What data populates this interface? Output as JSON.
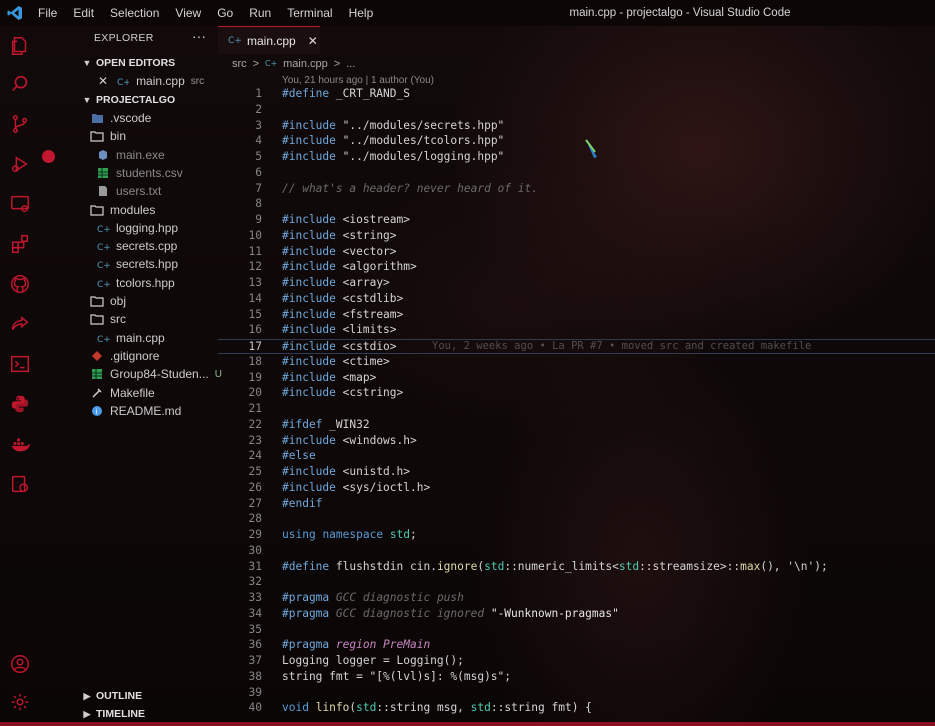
{
  "window": {
    "title": "main.cpp - projectalgo - Visual Studio Code"
  },
  "menu": [
    "File",
    "Edit",
    "Selection",
    "View",
    "Go",
    "Run",
    "Terminal",
    "Help"
  ],
  "colors": {
    "accent": "#c0162e",
    "keyword": "#569cd6",
    "type": "#4ec9b0",
    "function": "#dcdcaa",
    "comment": "#6a6a6a"
  },
  "activity_bar": [
    "explorer-icon",
    "search-icon",
    "source-control-icon",
    "run-debug-icon",
    "remote-explorer-icon",
    "extensions-icon",
    "github-icon",
    "live-share-icon",
    "terminal-icon",
    "python-icon",
    "docker-icon",
    "database-icon",
    "account-icon",
    "settings-gear-icon"
  ],
  "explorer": {
    "title": "EXPLORER",
    "more": "···",
    "open_editors": {
      "label": "OPEN EDITORS",
      "items": [
        {
          "name": "main.cpp",
          "suffix": "src"
        }
      ]
    },
    "project": {
      "label": "PROJECTALGO",
      "items": [
        {
          "name": ".vscode",
          "type": "folder",
          "depth": 1
        },
        {
          "name": "bin",
          "type": "folder",
          "depth": 1
        },
        {
          "name": "main.exe",
          "type": "file",
          "depth": 2,
          "dim": true
        },
        {
          "name": "students.csv",
          "type": "file",
          "depth": 2,
          "dim": true
        },
        {
          "name": "users.txt",
          "type": "file",
          "depth": 2,
          "dim": true
        },
        {
          "name": "modules",
          "type": "folder",
          "depth": 1
        },
        {
          "name": "logging.hpp",
          "type": "file",
          "depth": 2
        },
        {
          "name": "secrets.cpp",
          "type": "file",
          "depth": 2
        },
        {
          "name": "secrets.hpp",
          "type": "file",
          "depth": 2
        },
        {
          "name": "tcolors.hpp",
          "type": "file",
          "depth": 2
        },
        {
          "name": "obj",
          "type": "folder",
          "depth": 1
        },
        {
          "name": "src",
          "type": "folder",
          "depth": 1
        },
        {
          "name": "main.cpp",
          "type": "file",
          "depth": 2
        },
        {
          "name": ".gitignore",
          "type": "file",
          "depth": 1
        },
        {
          "name": "Group84-Studen...",
          "type": "file",
          "depth": 1,
          "badge": "U"
        },
        {
          "name": "Makefile",
          "type": "file",
          "depth": 1
        },
        {
          "name": "README.md",
          "type": "file",
          "depth": 1
        }
      ]
    },
    "outline": "OUTLINE",
    "timeline": "TIMELINE"
  },
  "tab": {
    "label": "main.cpp",
    "close": "✕"
  },
  "breadcrumb": [
    "src",
    ">",
    "main.cpp",
    ">",
    "..."
  ],
  "codelens": "You, 21 hours ago | 1 author (You)",
  "blame": "You, 2 weeks ago • La PR #7 • moved src and created makefile",
  "current_line": 17,
  "lines": [
    {
      "n": "1",
      "t": "#define _CRT_RAND_S"
    },
    {
      "n": "2",
      "t": ""
    },
    {
      "n": "3",
      "t": "#include \"../modules/secrets.hpp\""
    },
    {
      "n": "4",
      "t": "#include \"../modules/tcolors.hpp\""
    },
    {
      "n": "5",
      "t": "#include \"../modules/logging.hpp\""
    },
    {
      "n": "6",
      "t": ""
    },
    {
      "n": "7",
      "t": "// what's a header? never heard of it."
    },
    {
      "n": "8",
      "t": ""
    },
    {
      "n": "9",
      "t": "#include <iostream>"
    },
    {
      "n": "10",
      "t": "#include <string>"
    },
    {
      "n": "11",
      "t": "#include <vector>"
    },
    {
      "n": "12",
      "t": "#include <algorithm>"
    },
    {
      "n": "13",
      "t": "#include <array>"
    },
    {
      "n": "14",
      "t": "#include <cstdlib>"
    },
    {
      "n": "15",
      "t": "#include <fstream>"
    },
    {
      "n": "16",
      "t": "#include <limits>"
    },
    {
      "n": "17",
      "t": "#include <cstdio>"
    },
    {
      "n": "18",
      "t": "#include <ctime>"
    },
    {
      "n": "19",
      "t": "#include <map>"
    },
    {
      "n": "20",
      "t": "#include <cstring>"
    },
    {
      "n": "21",
      "t": ""
    },
    {
      "n": "22",
      "t": "#ifdef _WIN32"
    },
    {
      "n": "23",
      "t": "#include <windows.h>"
    },
    {
      "n": "24",
      "t": "#else"
    },
    {
      "n": "25",
      "t": "#include <unistd.h>"
    },
    {
      "n": "26",
      "t": "#include <sys/ioctl.h>"
    },
    {
      "n": "27",
      "t": "#endif"
    },
    {
      "n": "28",
      "t": ""
    },
    {
      "n": "29",
      "t": "using namespace std;"
    },
    {
      "n": "30",
      "t": ""
    },
    {
      "n": "31",
      "t": "#define flushstdin cin.ignore(std::numeric_limits<std::streamsize>::max(), '\\n');"
    },
    {
      "n": "32",
      "t": ""
    },
    {
      "n": "33",
      "t": "#pragma GCC diagnostic push"
    },
    {
      "n": "34",
      "t": "#pragma GCC diagnostic ignored \"-Wunknown-pragmas\""
    },
    {
      "n": "35",
      "t": ""
    },
    {
      "n": "36",
      "t": "#pragma region PreMain"
    },
    {
      "n": "37",
      "t": "Logging logger = Logging();"
    },
    {
      "n": "38",
      "t": "string fmt = \"[%(lvl)s]: %(msg)s\";"
    },
    {
      "n": "39",
      "t": ""
    },
    {
      "n": "40",
      "t": "void linfo(std::string msg, std::string fmt) {"
    }
  ]
}
